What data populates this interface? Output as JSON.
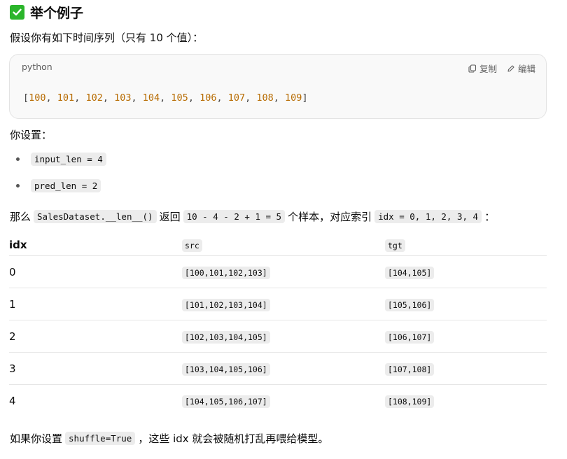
{
  "heading": {
    "check_icon": "white-check-mark-green",
    "title": "举个例子"
  },
  "intro": "假设你有如下时间序列（只有 10 个值）：",
  "code_block": {
    "language": "python",
    "copy_label": "复制",
    "edit_label": "编辑",
    "values": [
      "100",
      "101",
      "102",
      "103",
      "104",
      "105",
      "106",
      "107",
      "108",
      "109"
    ]
  },
  "setting_text": "你设置：",
  "bullets": [
    "input_len = 4",
    "pred_len = 2"
  ],
  "summary": {
    "part1": "那么",
    "code1": "SalesDataset.__len__()",
    "part2": "返回",
    "code2": "10 - 4 - 2 + 1 = 5",
    "part3": "个样本，对应索引",
    "code3": "idx = 0, 1, 2, 3, 4",
    "part4": "："
  },
  "table": {
    "headers": [
      "idx",
      "src",
      "tgt"
    ],
    "rows": [
      [
        "0",
        "[100,101,102,103]",
        "[104,105]"
      ],
      [
        "1",
        "[101,102,103,104]",
        "[105,106]"
      ],
      [
        "2",
        "[102,103,104,105]",
        "[106,107]"
      ],
      [
        "3",
        "[103,104,105,106]",
        "[107,108]"
      ],
      [
        "4",
        "[104,105,106,107]",
        "[108,109]"
      ]
    ]
  },
  "footer": {
    "part1": "如果你设置",
    "code": "shuffle=True",
    "part2": "，这些 idx 就会被随机打乱再喂给模型。"
  }
}
